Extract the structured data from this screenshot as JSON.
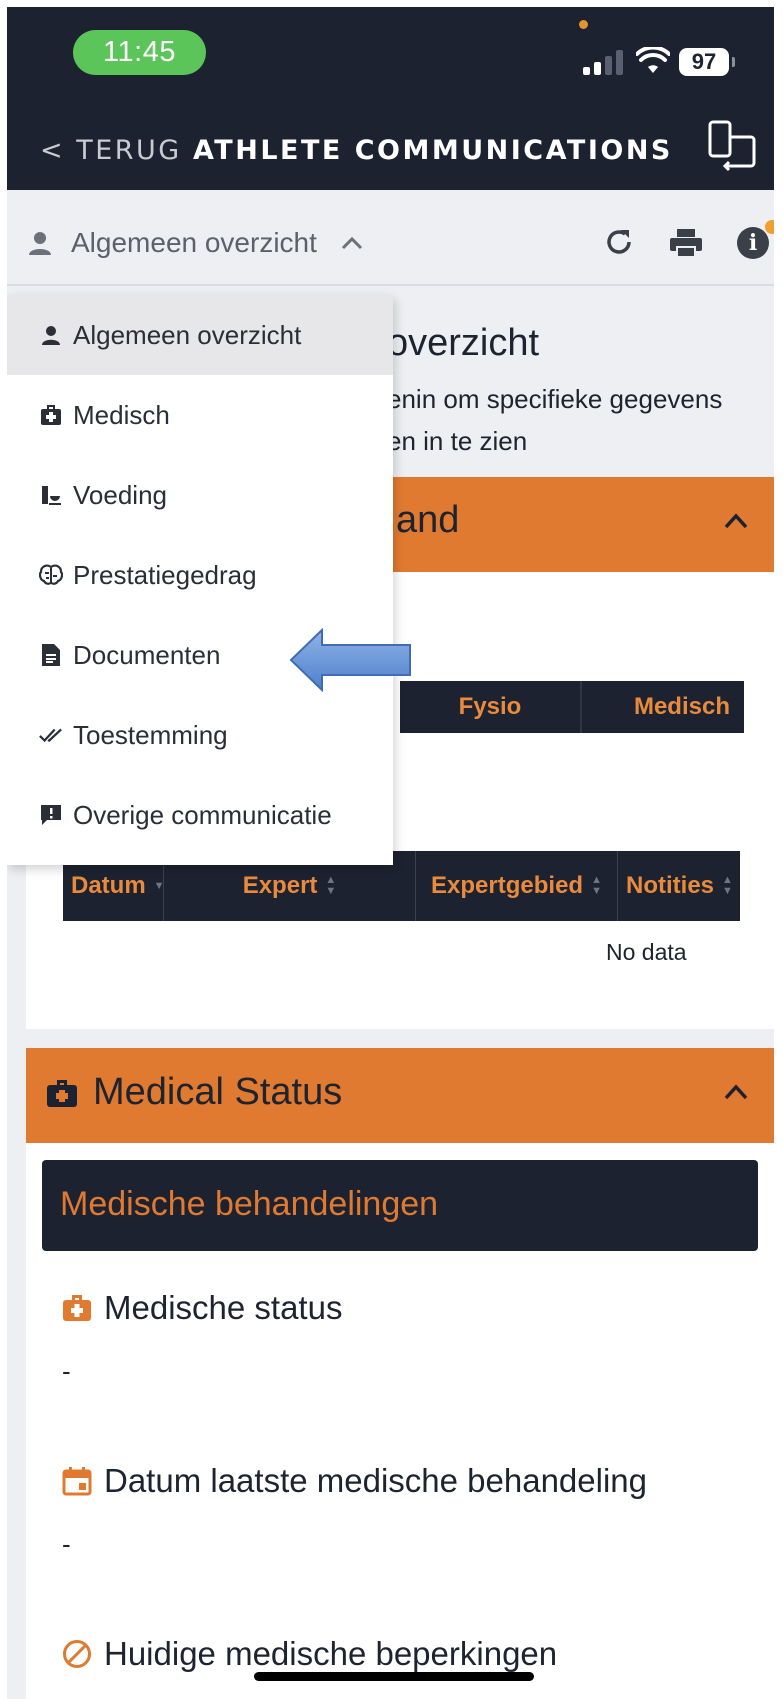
{
  "status_bar": {
    "time": "11:45",
    "battery": "97"
  },
  "header": {
    "back_label": "< TERUG",
    "title": "ATHLETE COMMUNICATIONS"
  },
  "toolbar": {
    "selected_view": "Algemeen overzicht"
  },
  "dropdown": {
    "items": [
      {
        "label": "Algemeen overzicht",
        "icon": "user-icon",
        "active": true
      },
      {
        "label": "Medisch",
        "icon": "medkit-icon",
        "active": false
      },
      {
        "label": "Voeding",
        "icon": "nutrition-icon",
        "active": false
      },
      {
        "label": "Prestatiegedrag",
        "icon": "brain-icon",
        "active": false
      },
      {
        "label": "Documenten",
        "icon": "document-icon",
        "active": false
      },
      {
        "label": "Toestemming",
        "icon": "double-check-icon",
        "active": false
      },
      {
        "label": "Overige communicatie",
        "icon": "comment-alert-icon",
        "active": false
      }
    ]
  },
  "overview": {
    "title_visible": "overzicht",
    "text_line1": "enin om specifieke gegevens",
    "text_line2": "en in te zien"
  },
  "card1": {
    "title_visible": "and",
    "chips": [
      "Fysio",
      "Medisch"
    ],
    "table": {
      "columns": [
        "Datum",
        "Expert",
        "Expertgebied",
        "Notities"
      ],
      "empty_text": "No data"
    }
  },
  "card2": {
    "title": "Medical Status",
    "subheader": "Medische behandelingen",
    "fields": [
      {
        "label": "Medische status",
        "value": "-",
        "icon": "medkit-icon"
      },
      {
        "label": "Datum laatste medische behandeling",
        "value": "-",
        "icon": "calendar-icon"
      },
      {
        "label": "Huidige medische beperkingen",
        "value": "",
        "icon": "prohibited-icon"
      }
    ]
  },
  "colors": {
    "navy": "#1c2230",
    "orange": "#e07a30",
    "status_green": "#5cc55a"
  }
}
